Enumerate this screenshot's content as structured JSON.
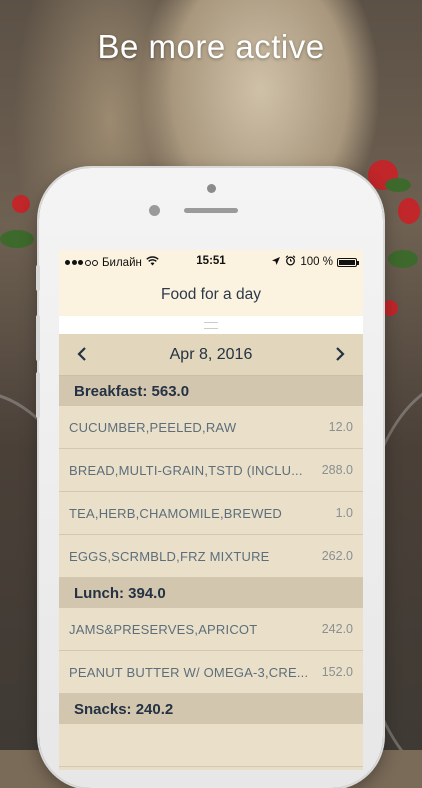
{
  "headline": "Be more active",
  "statusbar": {
    "carrier": "Билайн",
    "time": "15:51",
    "battery": "100 %",
    "icons": [
      "signal-dots-icon",
      "wifi-icon",
      "location-arrow-icon",
      "alarm-clock-icon",
      "battery-icon"
    ]
  },
  "nav": {
    "title": "Food for a day"
  },
  "datebar": {
    "date": "Apr 8, 2016",
    "prev_icon": "chevron-left-icon",
    "next_icon": "chevron-right-icon"
  },
  "sections": [
    {
      "title": "Breakfast: 563.0",
      "items": [
        {
          "name": "CUCUMBER,PEELED,RAW",
          "value": "12.0"
        },
        {
          "name": "BREAD,MULTI-GRAIN,TSTD (INCLU...",
          "value": "288.0"
        },
        {
          "name": "TEA,HERB,CHAMOMILE,BREWED",
          "value": "1.0"
        },
        {
          "name": "EGGS,SCRMBLD,FRZ MIXTURE",
          "value": "262.0"
        }
      ]
    },
    {
      "title": "Lunch: 394.0",
      "items": [
        {
          "name": "JAMS&PRESERVES,APRICOT",
          "value": "242.0"
        },
        {
          "name": "PEANUT BUTTER W/ OMEGA-3,CRE...",
          "value": "152.0"
        }
      ]
    },
    {
      "title": "Snacks: 240.2",
      "items": []
    }
  ]
}
